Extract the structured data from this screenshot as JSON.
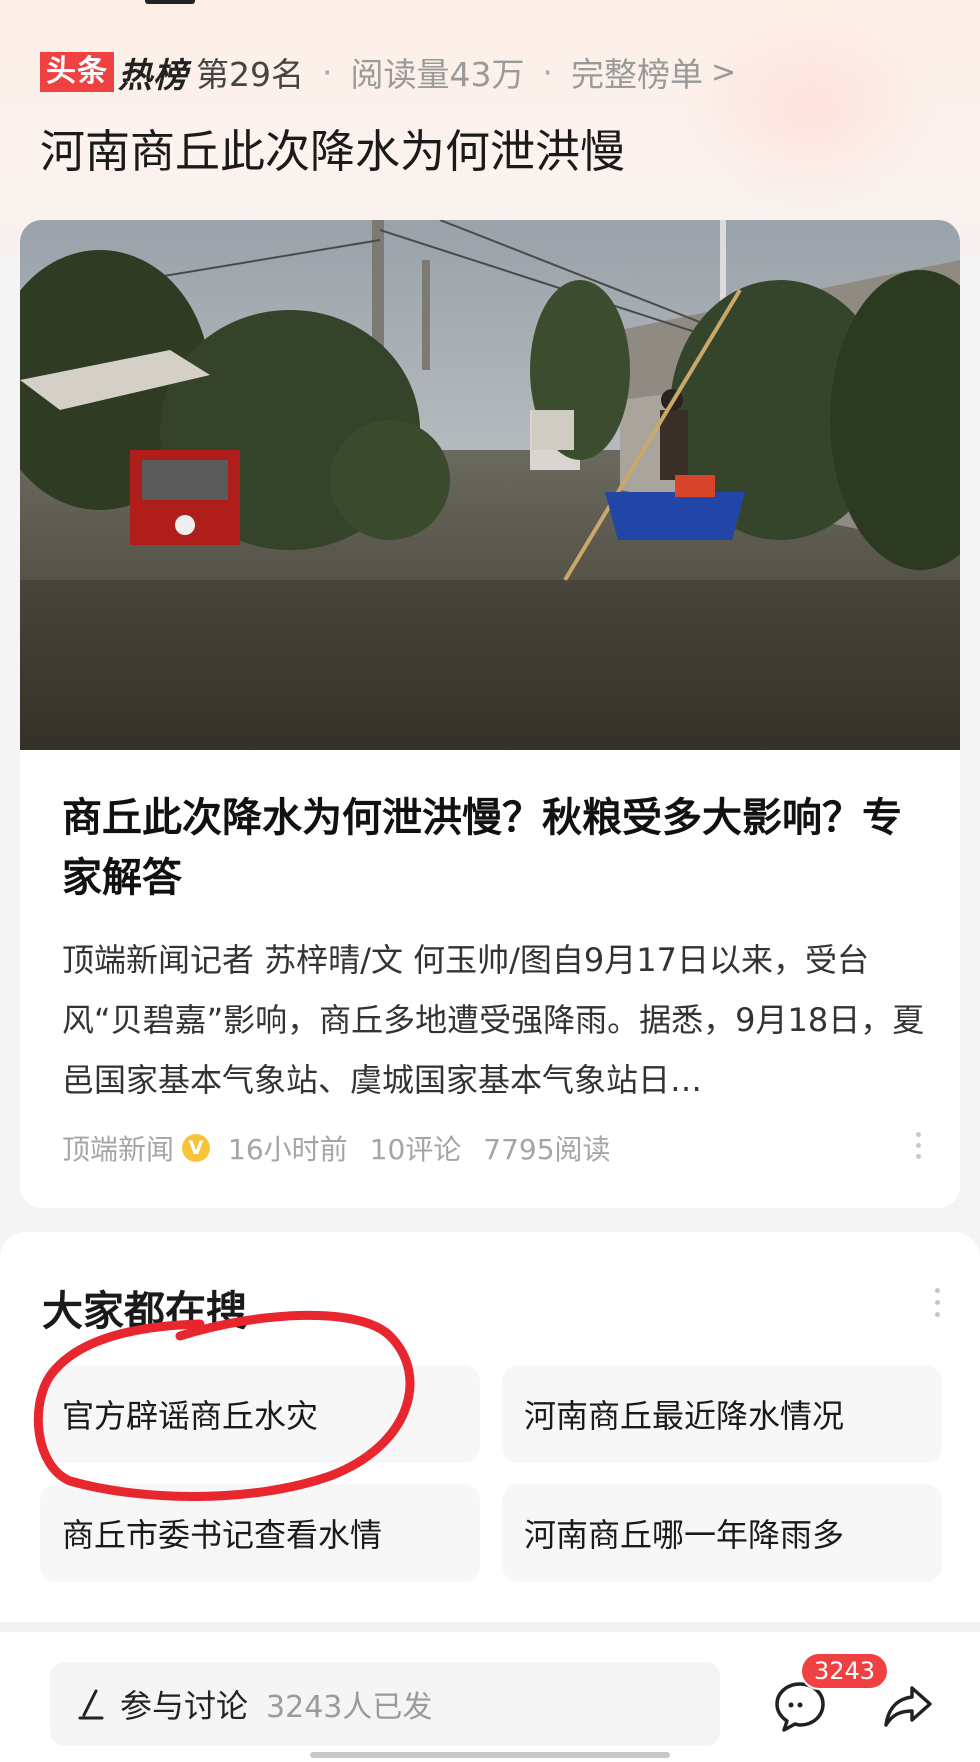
{
  "header": {
    "logo_toutiao": "头条",
    "logo_rebang": "热榜",
    "rank": "第29名",
    "separator": "·",
    "read_count": "阅读量43万",
    "full_list": "完整榜单",
    "chevron": ">"
  },
  "topic_title": "河南商丘此次降水为何泄洪慢",
  "article": {
    "image_icon": "flood-photo",
    "title": "商丘此次降水为何泄洪慢？秋粮受多大影响？专家解答",
    "summary": "顶端新闻记者 苏梓晴/文 何玉帅/图自9月17日以来，受台风“贝碧嘉”影响，商丘多地遭受强降雨。据悉，9月18日，夏邑国家基本气象站、虞城国家基本气象站日…",
    "source": "顶端新闻",
    "verified_badge": "V",
    "time": "16小时前",
    "comments": "10评论",
    "reads": "7795阅读"
  },
  "search": {
    "heading": "大家都在搜",
    "items": [
      "官方辟谣商丘水灾",
      "河南商丘最近降水情况",
      "商丘市委书记查看水情",
      "河南商丘哪一年降雨多"
    ]
  },
  "bottom_bar": {
    "discuss_label": "参与讨论",
    "discuss_count": "3243人已发",
    "comment_badge": "3243"
  },
  "colors": {
    "brand_red": "#f04142",
    "annotation_red": "#e8262e",
    "badge_yellow": "#f7c33b"
  }
}
